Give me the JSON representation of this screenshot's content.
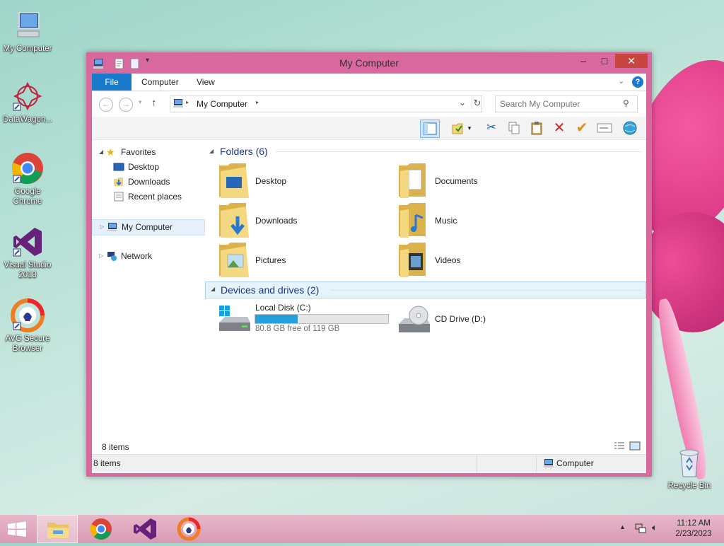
{
  "desktop": {
    "icons": [
      {
        "label": "My Computer",
        "icon": "computer-icon"
      },
      {
        "label": "DataWagon...",
        "icon": "datawagon-icon"
      },
      {
        "label": "Google Chrome",
        "icon": "chrome-icon"
      },
      {
        "label": "Visual Studio 2013",
        "icon": "visual-studio-icon"
      },
      {
        "label": "AVG Secure Browser",
        "icon": "avg-browser-icon"
      },
      {
        "label": "Recycle Bin",
        "icon": "recycle-bin-icon"
      }
    ]
  },
  "window": {
    "title": "My Computer",
    "ribbon_tabs": [
      "File",
      "Computer",
      "View"
    ],
    "address": {
      "path": "My Computer",
      "search_placeholder": "Search My Computer"
    },
    "nav_pane": {
      "favorites": "Favorites",
      "favorites_items": [
        "Desktop",
        "Downloads",
        "Recent places"
      ],
      "my_computer": "My Computer",
      "network": "Network"
    },
    "folders_group": "Folders (6)",
    "folders": [
      "Desktop",
      "Documents",
      "Downloads",
      "Music",
      "Pictures",
      "Videos"
    ],
    "devices_group": "Devices and drives (2)",
    "drives": [
      {
        "name": "Local Disk (C:)",
        "free_text": "80.8 GB free of 119 GB",
        "used_fraction": 0.32
      },
      {
        "name": "CD Drive (D:)"
      }
    ],
    "content_status": "8 items",
    "status_left": "8 items",
    "status_right": "Computer"
  },
  "taskbar": {
    "time": "11:12 AM",
    "date": "2/23/2023",
    "pinned": [
      "file-explorer-icon",
      "chrome-icon",
      "visual-studio-icon",
      "avg-browser-icon"
    ]
  },
  "colors": {
    "window_frame": "#d8689e",
    "accent": "#1979ca",
    "group_header": "#1e3287",
    "taskbar": "#dba1b8"
  }
}
